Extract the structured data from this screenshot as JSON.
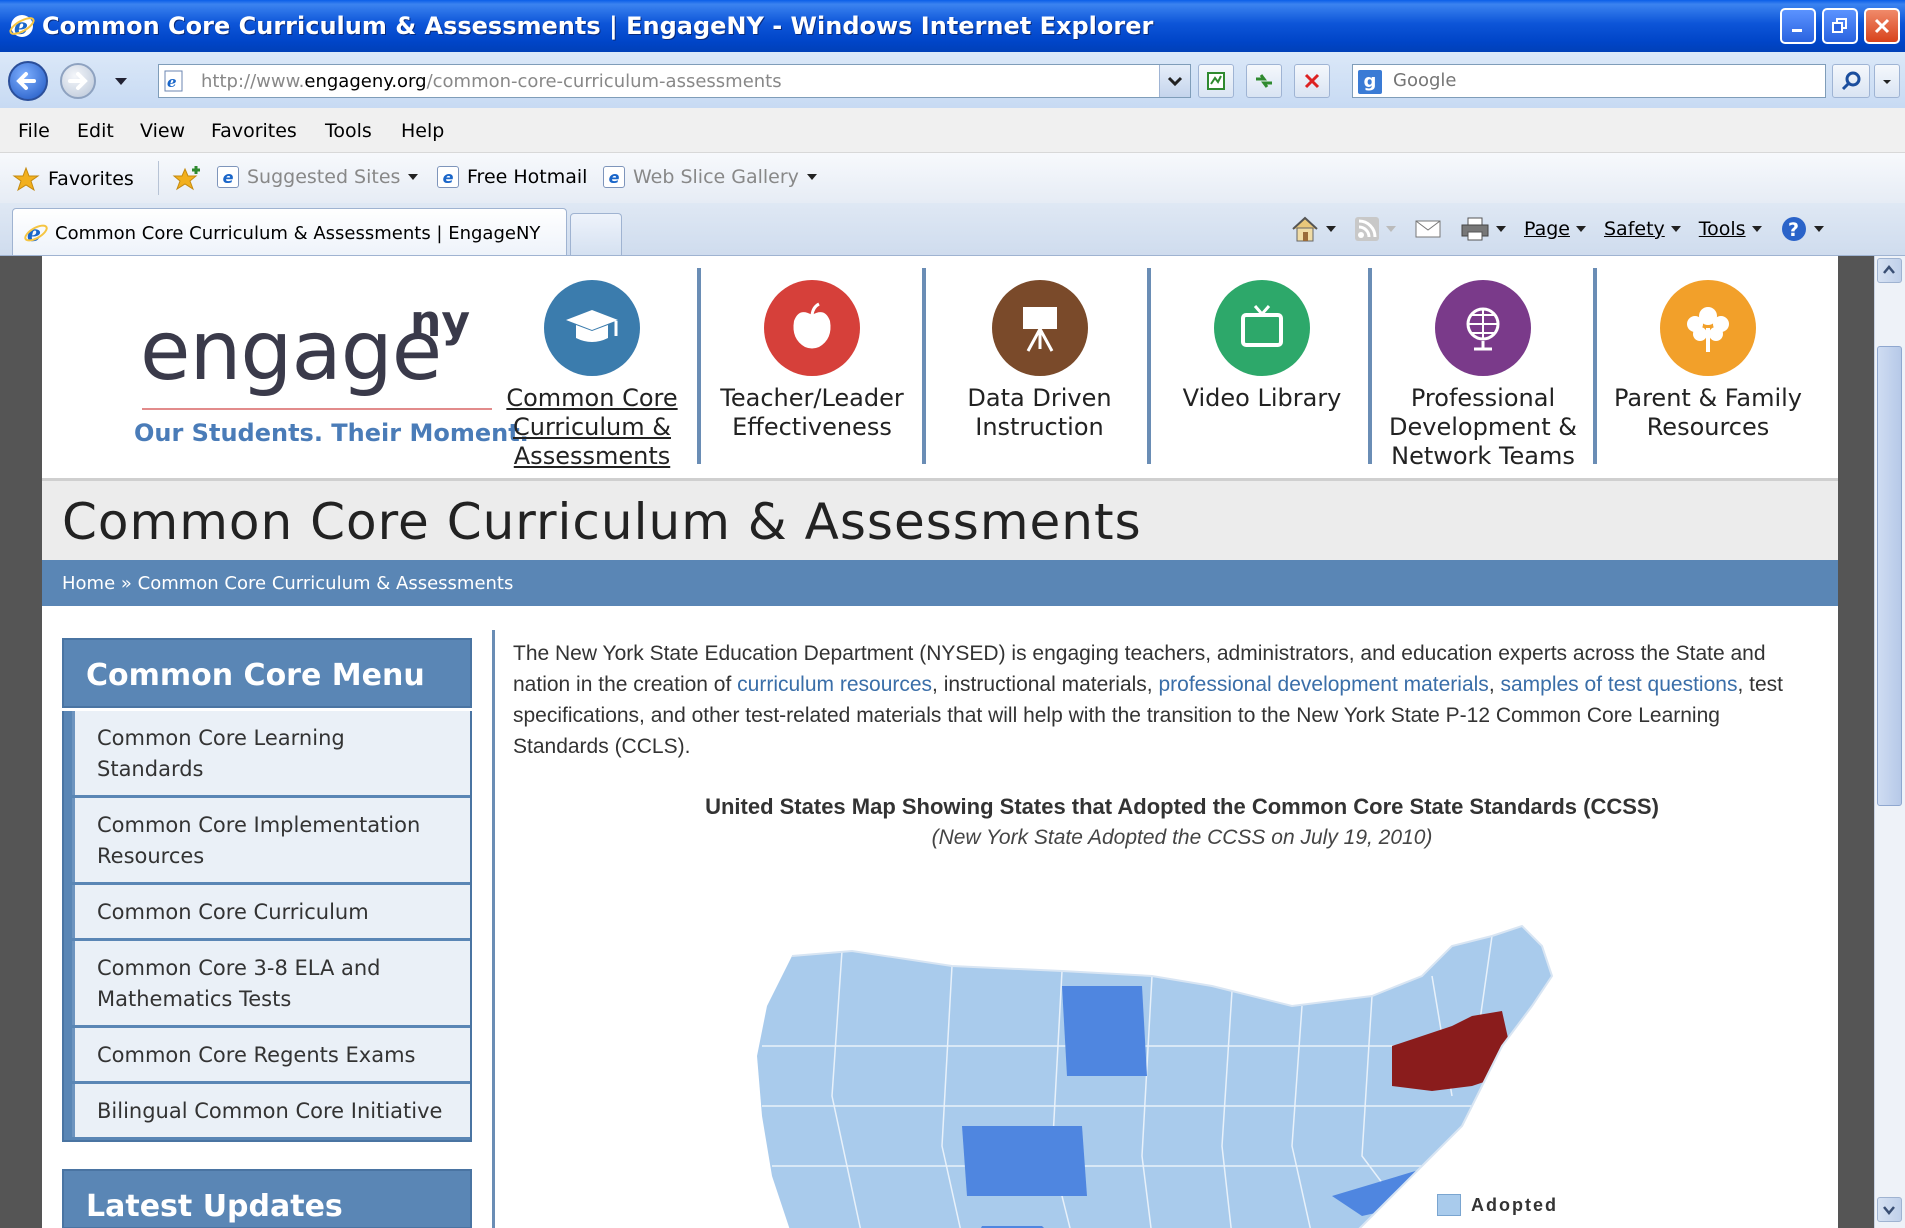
{
  "window": {
    "title": "Common Core Curriculum & Assessments | EngageNY - Windows Internet Explorer"
  },
  "address": {
    "url_prefix": "http://www.",
    "url_domain": "engageny.org",
    "url_path": "/common-core-curriculum-assessments",
    "search_placeholder": "Google"
  },
  "menu": [
    "File",
    "Edit",
    "View",
    "Favorites",
    "Tools",
    "Help"
  ],
  "favorites_bar": {
    "favorites_label": "Favorites",
    "items": [
      "Suggested Sites",
      "Free Hotmail",
      "Web Slice Gallery"
    ]
  },
  "tab": {
    "title": "Common Core Curriculum & Assessments | EngageNY"
  },
  "command_bar": {
    "page": "Page",
    "safety": "Safety",
    "tools": "Tools"
  },
  "site": {
    "logo_main": "engage",
    "logo_super": "ny",
    "tagline": "Our Students. Their Moment.",
    "nav": [
      {
        "line1": "Common Core",
        "line2": "Curriculum &",
        "line3": "Assessments",
        "color": "#3b7cad"
      },
      {
        "line1": "Teacher/Leader",
        "line2": "Effectiveness",
        "line3": "",
        "color": "#d6403a"
      },
      {
        "line1": "Data Driven",
        "line2": "Instruction",
        "line3": "",
        "color": "#7a4a2a"
      },
      {
        "line1": "Video Library",
        "line2": "",
        "line3": "",
        "color": "#2da86a"
      },
      {
        "line1": "Professional",
        "line2": "Development &",
        "line3": "Network Teams",
        "color": "#7a3a8a"
      },
      {
        "line1": "Parent & Family",
        "line2": "Resources",
        "line3": "",
        "color": "#f2a02a"
      }
    ],
    "page_title": "Common Core Curriculum & Assessments",
    "breadcrumb": {
      "home": "Home",
      "sep": "»",
      "current": "Common Core Curriculum & Assessments"
    }
  },
  "sidebar": {
    "heading": "Common Core Menu",
    "items": [
      "Common Core Learning Standards",
      "Common Core Implementation Resources",
      "Common Core Curriculum",
      "Common Core 3-8 ELA and Mathematics Tests",
      "Common Core Regents Exams",
      "Bilingual Common Core Initiative"
    ],
    "heading2": "Latest Updates"
  },
  "main": {
    "intro_1": "The New York State Education Department (NYSED) is engaging teachers, administrators, and education experts across the State and nation in the creation of ",
    "link_1": "curriculum resources",
    "intro_2": ", instructional materials, ",
    "link_2": "professional development materials",
    "intro_3": ", ",
    "link_3": "samples of test questions",
    "intro_4": ", test specifications, and other test-related materials that will help with the transition to the New York State P-12 Common Core Learning Standards (CCLS).",
    "map_title": "United States Map Showing States that Adopted the Common Core State Standards (CCSS)",
    "map_subtitle": "(New York State Adopted the CCSS on July 19, 2010)",
    "legend": "Adopted",
    "colors": {
      "adopted": "#a9cbec",
      "non_adopted": "#4f86e0",
      "new_york": "#8a1c1c"
    }
  }
}
